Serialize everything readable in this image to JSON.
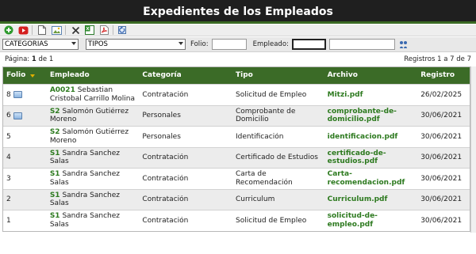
{
  "title": "Expedientes de los Empleados",
  "toolbar": {
    "buttons": [
      "add-icon",
      "play-icon",
      "new-document-icon",
      "image-icon",
      "delete-icon",
      "excel-icon",
      "pdf-icon",
      "refresh-icon"
    ]
  },
  "filters": {
    "category_value": "CATEGORIAS",
    "type_value": "TIPOS",
    "folio_label": "Folio:",
    "folio_value": "",
    "employee_label": "Empleado:",
    "employee_value": "",
    "employee_name_value": ""
  },
  "pager": {
    "page_prefix": "Página:",
    "page_current": "1",
    "page_of": "de 1",
    "records_text": "Registros 1 a 7 de 7"
  },
  "table": {
    "headers": [
      "Folio",
      "Empleado",
      "Categoría",
      "Tipo",
      "Archivo",
      "Registro"
    ],
    "rows": [
      {
        "folio": "8",
        "code": "A0021",
        "name": "Sebastian Cristobal Carrillo Molina",
        "categoria": "Contratación",
        "tipo": "Solicitud de Empleo",
        "archivo": "Mitzi.pdf",
        "registro": "26/02/2025",
        "icon": true
      },
      {
        "folio": "6",
        "code": "S2",
        "name": "Salomón Gutiérrez Moreno",
        "categoria": "Personales",
        "tipo": "Comprobante de Domicilio",
        "archivo": "comprobante-de-domicilio.pdf",
        "registro": "30/06/2021",
        "icon": true
      },
      {
        "folio": "5",
        "code": "S2",
        "name": "Salomón Gutiérrez Moreno",
        "categoria": "Personales",
        "tipo": "Identificación",
        "archivo": "identificacion.pdf",
        "registro": "30/06/2021",
        "icon": false
      },
      {
        "folio": "4",
        "code": "S1",
        "name": "Sandra Sanchez Salas",
        "categoria": "Contratación",
        "tipo": "Certificado de Estudios",
        "archivo": "certificado-de-estudios.pdf",
        "registro": "30/06/2021",
        "icon": false
      },
      {
        "folio": "3",
        "code": "S1",
        "name": "Sandra Sanchez Salas",
        "categoria": "Contratación",
        "tipo": "Carta de Recomendación",
        "archivo": "Carta-recomendacion.pdf",
        "registro": "30/06/2021",
        "icon": false
      },
      {
        "folio": "2",
        "code": "S1",
        "name": "Sandra Sanchez Salas",
        "categoria": "Contratación",
        "tipo": "Curriculum",
        "archivo": "Curriculum.pdf",
        "registro": "30/06/2021",
        "icon": false
      },
      {
        "folio": "1",
        "code": "S1",
        "name": "Sandra Sanchez Salas",
        "categoria": "Contratación",
        "tipo": "Solicitud de Empleo",
        "archivo": "solicitud-de-empleo.pdf",
        "registro": "30/06/2021",
        "icon": false
      }
    ]
  }
}
